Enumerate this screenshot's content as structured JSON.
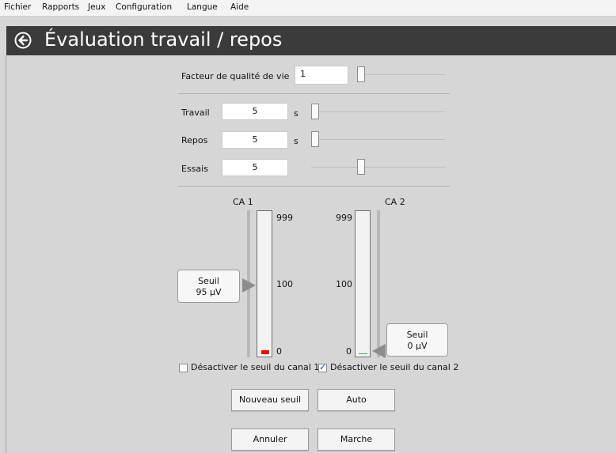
{
  "menu": [
    "Fichier",
    "Rapports",
    "Jeux",
    "Configuration",
    "Langue",
    "Aide"
  ],
  "header": {
    "title": "Évaluation travail / repos",
    "back_icon": "back-arrow-circle-icon"
  },
  "qualite": {
    "label": "Facteur de qualité de vie",
    "value": "1",
    "slider_fraction": 0.0
  },
  "travail": {
    "label": "Travail",
    "value": "5",
    "unit": "s",
    "slider_fraction": 0.0
  },
  "repos": {
    "label": "Repos",
    "value": "5",
    "unit": "s",
    "slider_fraction": 0.0
  },
  "essais": {
    "label": "Essais",
    "value": "5",
    "slider_fraction": 0.36
  },
  "channel1": {
    "title": "CA 1",
    "max": "999",
    "mid": "100",
    "min": "0",
    "seuil_line1": "Seuil",
    "seuil_line2": "95 µV",
    "checkbox_label": "Désactiver le seuil du canal 1",
    "checked": false,
    "level_color": "#e81010"
  },
  "channel2": {
    "title": "CA 2",
    "max": "999",
    "mid": "100",
    "min": "0",
    "seuil_line1": "Seuil",
    "seuil_line2": "0 µV",
    "checkbox_label": "Désactiver le seuil du canal 2",
    "checked": true,
    "level_color": "#3bb03b"
  },
  "buttons": {
    "nouveau_seuil": "Nouveau seuil",
    "auto": "Auto",
    "annuler": "Annuler",
    "marche": "Marche"
  },
  "colors": {
    "title_bar": "#3b3b3b",
    "background": "#d6d6d6"
  }
}
